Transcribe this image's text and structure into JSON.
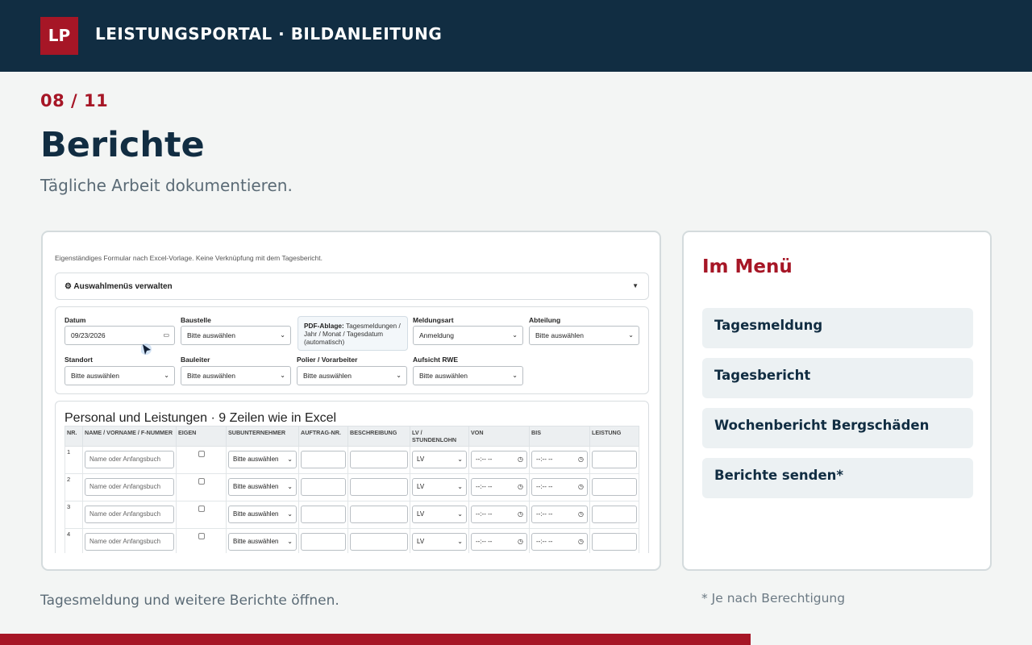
{
  "header": {
    "logo_text": "LP",
    "title": "LEISTUNGSPORTAL · BILDANLEITUNG"
  },
  "step": {
    "counter": "08 / 11",
    "title": "Berichte",
    "subtitle": "Tägliche Arbeit dokumentieren."
  },
  "screenshot": {
    "note": "Eigenständiges Formular nach Excel-Vorlage. Keine Verknüpfung mit dem Tagesbericht.",
    "accordion_label": "⚙ Auswahlmenüs verwalten",
    "form": {
      "datum_label": "Datum",
      "datum_value": "09/23/2026",
      "baustelle_label": "Baustelle",
      "baustelle_value": "Bitte auswählen",
      "pdf_label": "PDF-Ablage:",
      "pdf_text": "Tagesmeldungen / Jahr / Monat / Tagesdatum (automatisch)",
      "meldungsart_label": "Meldungsart",
      "meldungsart_value": "Anmeldung",
      "abteilung_label": "Abteilung",
      "abteilung_value": "Bitte auswählen",
      "standort_label": "Standort",
      "standort_value": "Bitte auswählen",
      "bauleiter_label": "Bauleiter",
      "bauleiter_value": "Bitte auswählen",
      "polier_label": "Polier / Vorarbeiter",
      "polier_value": "Bitte auswählen",
      "aufsicht_label": "Aufsicht RWE",
      "aufsicht_value": "Bitte auswählen"
    },
    "table": {
      "title": "Personal und Leistungen · 9 Zeilen wie in Excel",
      "headers": [
        "NR.",
        "NAME / VORNAME / F-NUMMER",
        "EIGEN",
        "SUBUNTERNEHMER",
        "AUFTRAG-NR.",
        "BESCHREIBUNG",
        "LV / STUNDENLOHN",
        "VON",
        "BIS",
        "LEISTUNG"
      ],
      "name_placeholder": "Name oder Anfangsbuch",
      "sub_value": "Bitte auswählen",
      "lv_value": "LV",
      "time_value": "--:-- --",
      "rows": [
        "1",
        "2",
        "3",
        "4"
      ]
    }
  },
  "menu": {
    "title": "Im Menü",
    "items": [
      "Tagesmeldung",
      "Tagesbericht",
      "Wochenbericht Bergschäden",
      "Berichte senden*"
    ]
  },
  "caption": "Tagesmeldung und weitere Berichte öffnen.",
  "footnote": "* Je nach Berechtigung",
  "progress": {
    "fraction": 0.727
  },
  "colors": {
    "brand_dark": "#112d42",
    "accent": "#a61626"
  }
}
